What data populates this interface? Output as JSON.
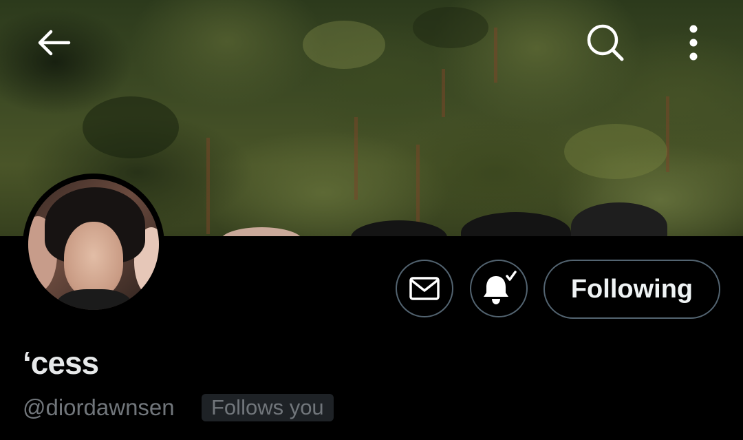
{
  "header": {
    "back_icon": "back-arrow-icon",
    "search_icon": "search-icon",
    "more_icon": "more-vertical-icon"
  },
  "profile": {
    "display_name": "ʻcess",
    "handle": "@diordawnsen",
    "follows_you_label": "Follows you"
  },
  "actions": {
    "message_icon": "mail-icon",
    "notification_icon": "bell-check-icon",
    "following_label": "Following"
  },
  "colors": {
    "background": "#000000",
    "button_border": "#536471",
    "secondary_text": "#71767b",
    "primary_text": "#e7e9ea",
    "badge_background": "#1e2226"
  }
}
